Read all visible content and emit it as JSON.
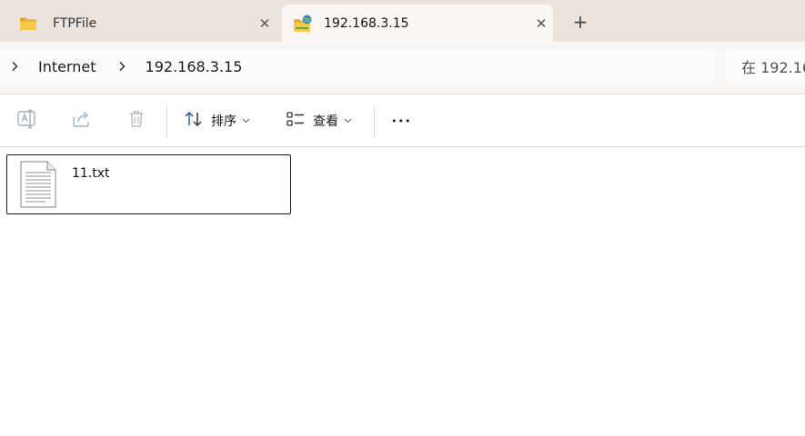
{
  "tabs": [
    {
      "label": "FTPFile",
      "icon": "folder-icon",
      "active": false
    },
    {
      "label": "192.168.3.15",
      "icon": "network-location-icon",
      "active": true
    }
  ],
  "tab_close_glyph": "✕",
  "new_tab_glyph": "+",
  "address": {
    "crumbs": [
      "Internet",
      "192.168.3.15"
    ]
  },
  "search": {
    "placeholder": "在 192.16"
  },
  "commandbar": {
    "icons": [
      "rename-icon",
      "share-icon",
      "delete-icon"
    ],
    "sort_label": "排序",
    "view_label": "查看",
    "more_glyph": "•••"
  },
  "files": [
    {
      "name": "11.txt",
      "icon": "text-file-icon"
    }
  ],
  "colors": {
    "tabstrip_bg": "#ebe4de",
    "active_tab_bg": "#f9f6f3",
    "folder_yellow": "#f3c33c",
    "accent_blue": "#2f6fb0"
  }
}
